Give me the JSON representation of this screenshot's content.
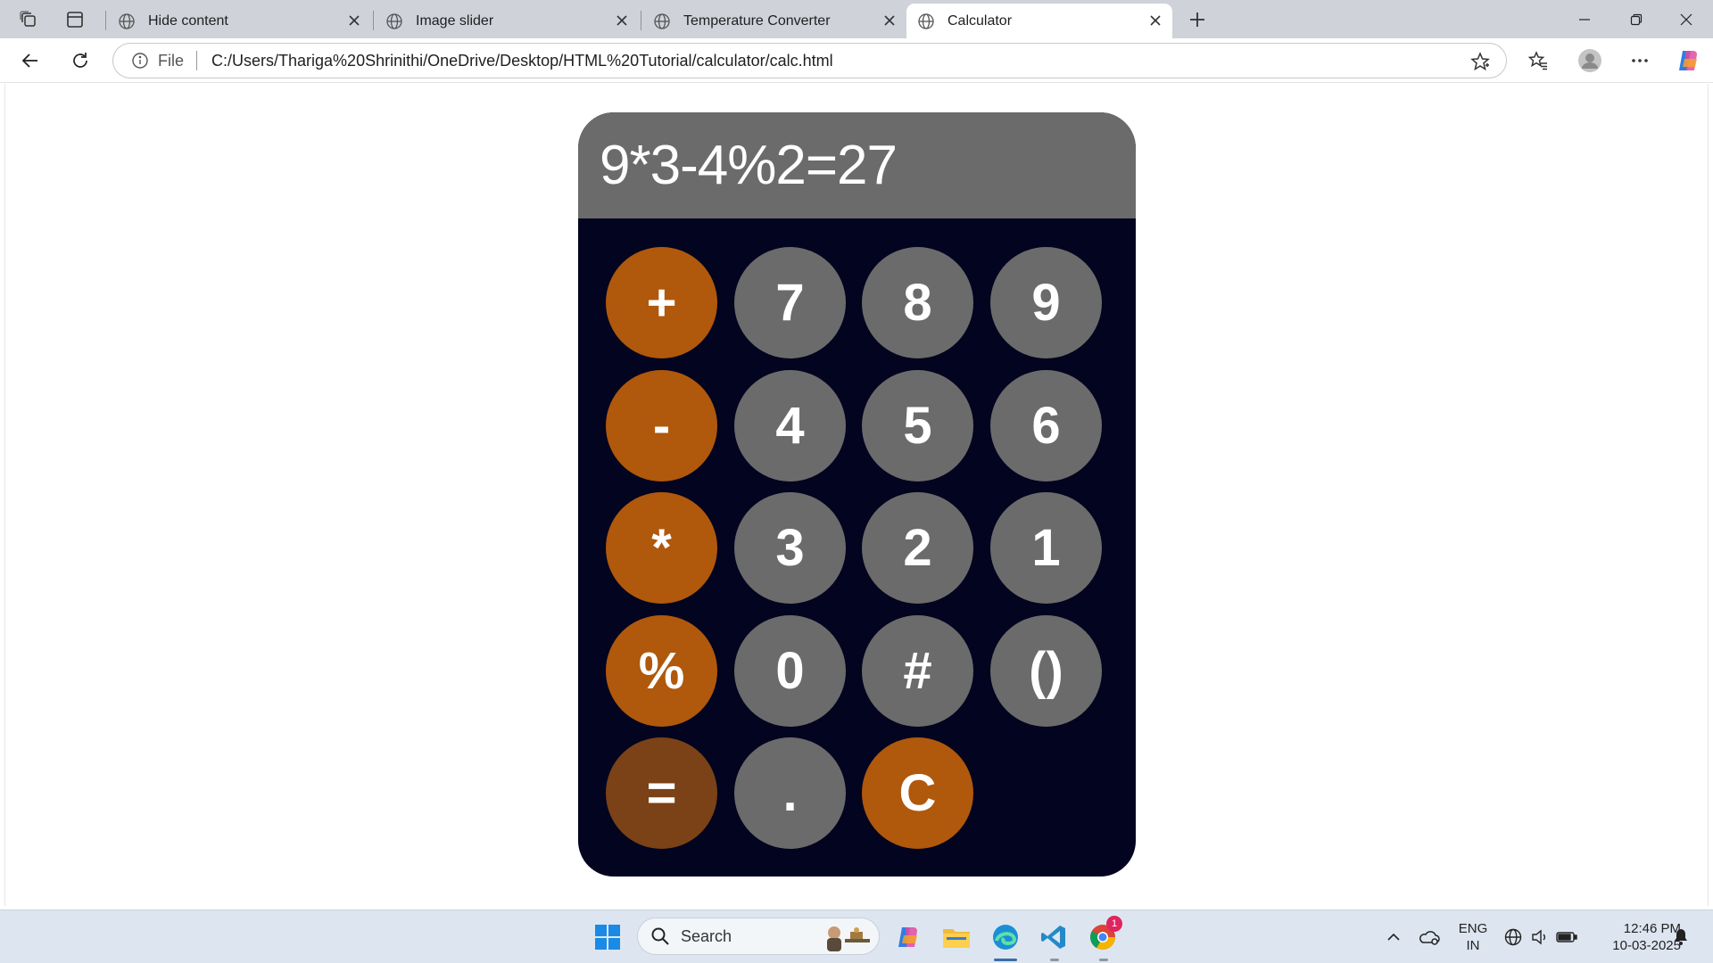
{
  "tabs": [
    {
      "title": "Hide content",
      "active": false
    },
    {
      "title": "Image slider",
      "active": false
    },
    {
      "title": "Temperature Converter",
      "active": false
    },
    {
      "title": "Calculator",
      "active": true
    }
  ],
  "address": {
    "scheme_label": "File",
    "url": "C:/Users/Thariga%20Shrinithi/OneDrive/Desktop/HTML%20Tutorial/calculator/calc.html"
  },
  "calculator": {
    "display": "9*3-4%2=27",
    "keys": {
      "plus": "+",
      "seven": "7",
      "eight": "8",
      "nine": "9",
      "minus": "-",
      "four": "4",
      "five": "5",
      "six": "6",
      "multiply": "*",
      "three": "3",
      "two": "2",
      "one": "1",
      "percent": "%",
      "zero": "0",
      "hash": "#",
      "parens": "()",
      "equals": "=",
      "dot": ".",
      "clear": "C"
    }
  },
  "taskbar": {
    "search_label": "Search",
    "language": "ENG",
    "region": "IN",
    "time": "12:46 PM",
    "date": "10-03-2025",
    "badge": "1"
  },
  "colors": {
    "display_bg": "#6b6b6b",
    "keypad_bg": "#03041f",
    "number_key": "#6b6b6b",
    "operator_key": "#b0580c",
    "equals_key": "#7a4216"
  }
}
